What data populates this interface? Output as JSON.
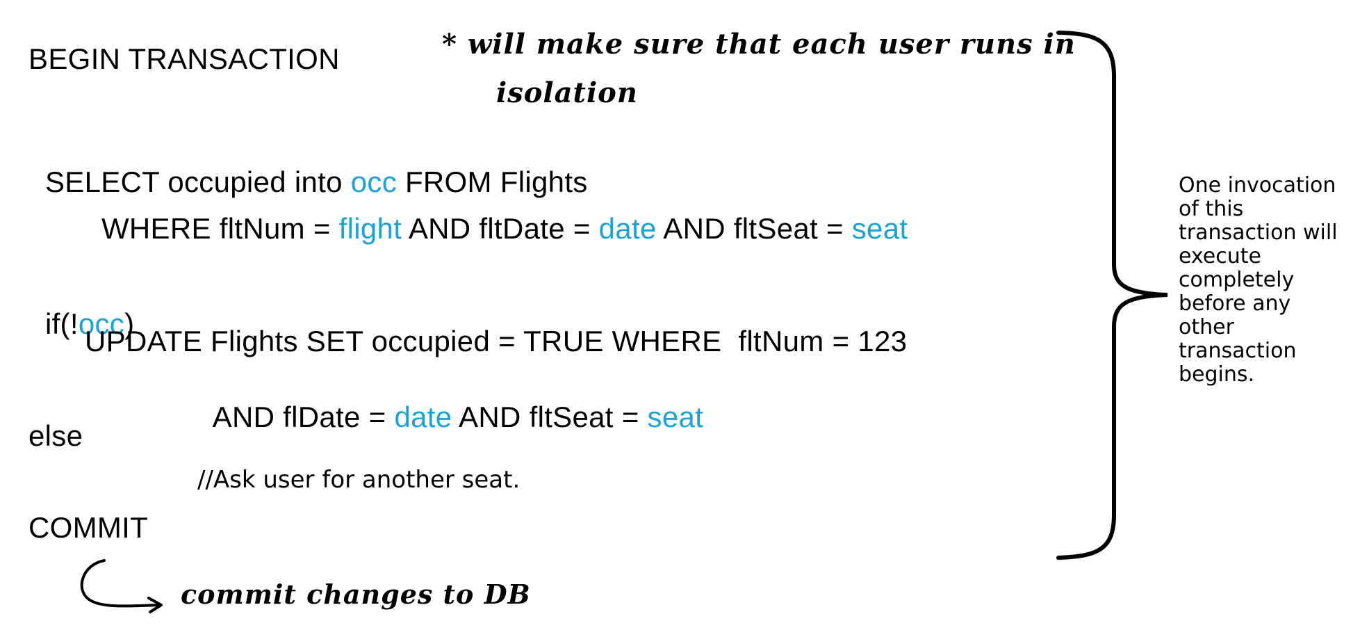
{
  "code": {
    "begin": "BEGIN TRANSACTION",
    "select_line": {
      "part1": "SELECT occupied into ",
      "var1": "occ",
      "part2": " FROM Flights"
    },
    "where_line": {
      "part1": "WHERE fltNum = ",
      "var1": "flight",
      "part2": " AND fltDate = ",
      "var2": "date",
      "part3": " AND fltSeat = ",
      "var3": "seat"
    },
    "if_line": {
      "part1": "if(!",
      "var1": "occ",
      "part2": ")"
    },
    "update_line": "UPDATE Flights SET occupied = TRUE WHERE  fltNum = 123",
    "and_line": {
      "part1": "AND flDate = ",
      "var1": "date",
      "part2": " AND fltSeat = ",
      "var2": "seat"
    },
    "else": "else",
    "comment": "//Ask user for another seat.",
    "commit": "COMMIT"
  },
  "side_note": {
    "lines": [
      "One invocation",
      "of this",
      "transaction will",
      "execute",
      "completely",
      "before any",
      "other",
      "transaction",
      "begins."
    ]
  },
  "handwritten": {
    "note_line1": "* will make sure that each user runs in",
    "note_line2": "isolation",
    "commit_note": "commit changes to DB"
  },
  "colors": {
    "variable": "#1aa3d9",
    "text": "#000000",
    "background": "#ffffff"
  }
}
